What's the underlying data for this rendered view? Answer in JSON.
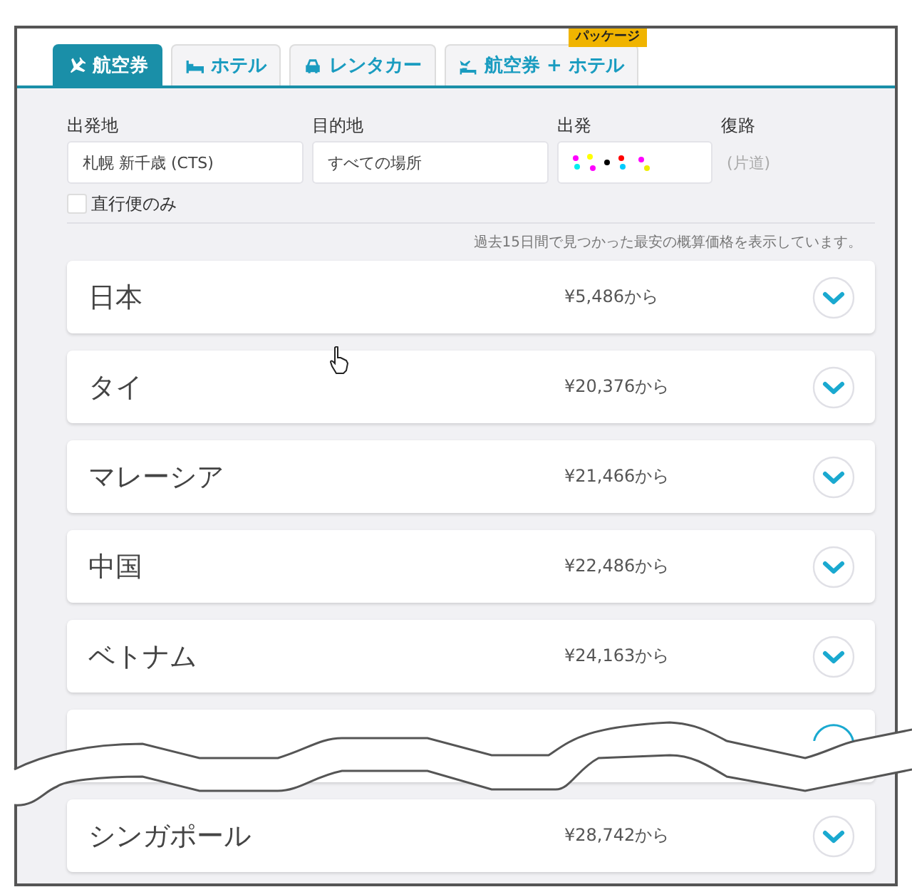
{
  "tabs": [
    {
      "label": "航空券",
      "selected": true
    },
    {
      "label": "ホテル",
      "selected": false
    },
    {
      "label": "レンタカー",
      "selected": false
    },
    {
      "label": "航空券 + ホテル",
      "selected": false,
      "badge": "パッケージ"
    }
  ],
  "search": {
    "fields": [
      {
        "label": "出発地",
        "kind": "text",
        "value": "札幌 新千歳 (CTS)"
      },
      {
        "label": "目的地",
        "kind": "text",
        "value": "すべての場所"
      },
      {
        "label": "出発",
        "kind": "blurred"
      },
      {
        "label": "復路",
        "kind": "bare",
        "placeholder": "(片道)"
      }
    ],
    "direct_only": {
      "label": "直行便のみ",
      "checked": false
    }
  },
  "notice": "過去15日間で見つかった最安の概算価格を表示しています。",
  "results": [
    {
      "kind": "card",
      "country": "日本",
      "price": "¥5,486から"
    },
    {
      "kind": "card",
      "country": "タイ",
      "price": "¥20,376から"
    },
    {
      "kind": "card",
      "country": "マレーシア",
      "price": "¥21,466から"
    },
    {
      "kind": "card",
      "country": "中国",
      "price": "¥22,486から"
    },
    {
      "kind": "card",
      "country": "ベトナム",
      "price": "¥24,163から"
    },
    {
      "kind": "torn"
    },
    {
      "kind": "card",
      "country": "シンガポール",
      "price": "¥28,742から"
    }
  ]
}
